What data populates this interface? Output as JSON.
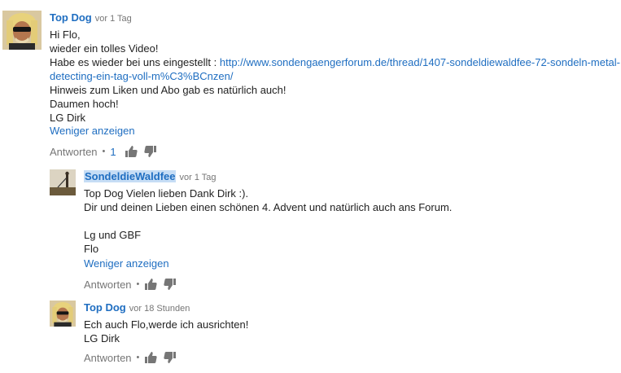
{
  "comments": [
    {
      "author": "Top Dog",
      "time": "vor 1 Tag",
      "lines": [
        "Hi Flo,",
        "wieder ein tolles Video!",
        "Habe es wieder bei uns eingestellt : "
      ],
      "link_part1": "http://www.sondengaengerforum.de/thread/1407-sondeldiewaldfee-72-sondeln-metal-",
      "link_part2": "detecting-ein-tag-voll-m%C3%BCnzen/",
      "lines_after": [
        "Hinweis zum Liken und Abo gab es natürlich auch!",
        "Daumen hoch!",
        "LG Dirk"
      ],
      "show_less": "Weniger anzeigen",
      "reply_label": "Antworten",
      "reply_count": "1"
    },
    {
      "author": "SondeldieWaldfee",
      "time": "vor 1 Tag",
      "lines": [
        "Top Dog Vielen lieben Dank Dirk :).",
        "Dir und deinen Lieben einen schönen 4. Advent und natürlich auch ans Forum.",
        "",
        "Lg und GBF",
        "Flo"
      ],
      "show_less": "Weniger anzeigen",
      "reply_label": "Antworten"
    },
    {
      "author": "Top Dog",
      "time": "vor 18 Stunden",
      "lines": [
        "Ech auch Flo,werde ich ausrichten!",
        "LG Dirk"
      ],
      "reply_label": "Antworten"
    }
  ],
  "icons": {
    "like": "thumbs-up-icon",
    "dislike": "thumbs-down-icon"
  },
  "colors": {
    "link": "#1f6ec1",
    "meta": "#767676",
    "author_highlight": "#c6ddf5"
  }
}
